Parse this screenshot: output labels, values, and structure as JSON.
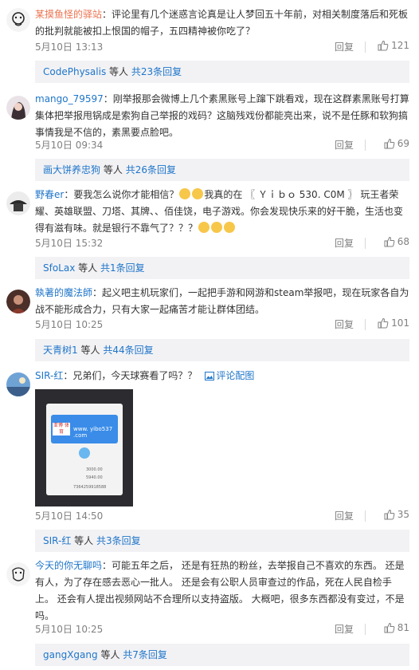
{
  "comments": [
    {
      "user": "某摸鱼怪的驿站",
      "text": "：评论里有几个迷惑言论真是让人梦回五十年前，对相关制度落后和死板的批判就能被扣上恨国的帽子，五四精神被你吃了？",
      "time": "5月10日 13:13",
      "reply_label": "回复",
      "likes": "121",
      "sub_user": "CodePhysalis",
      "sub_others": "等人",
      "sub_total": "共23条回复"
    },
    {
      "user": "mango_79597",
      "text": "：刚举报那会微博上几个素黑账号上蹿下跳看戏，现在这群素黑账号打算集体把举报甩锅成是索狗自己举报的戏码？这脑残戏份都能亮出来，说不是任豚和软狗搞事情我是不信的，素黑要点脸吧。",
      "time": "5月10日 09:34",
      "reply_label": "回复",
      "likes": "69",
      "sub_user": "画大饼养忠狗",
      "sub_others": "等人",
      "sub_total": "共26条回复"
    },
    {
      "user": "野春er",
      "text_a": "：要我怎么说你才能相信？",
      "text_b": "我真的在 〖 Ｙｉｂｏ 530. C0M 〗 玩王者荣耀、英雄联盟、刀塔、其牌、、佰佳饶，电子游戏。你会发现快乐来的好干脆，生活也变得有滋有味。就是银行不靠气了",
      "text_c": "？？？",
      "time": "5月10日 15:32",
      "reply_label": "回复",
      "likes": "68",
      "sub_user": "SfoLax",
      "sub_others": "等人",
      "sub_total": "共1条回复"
    },
    {
      "user": "執著的魔法師",
      "text": "：起义吧主机玩家们，一起把手游和网游和steam举报吧，现在玩家各自为战不能形成合力，只有大家一起痛苦才能让群体团结。",
      "time": "5月10日 10:25",
      "reply_label": "回复",
      "likes": "101",
      "sub_user": "天青树1",
      "sub_others": "等人",
      "sub_total": "共44条回复"
    },
    {
      "user": "SIR-红",
      "text": "：兄弟们，今天球赛看了吗？？",
      "pic_link": "评论配图",
      "image_site": "www. yibo537 .com",
      "image_badge": "亚博 体育",
      "image_line_1": "3000.00",
      "image_line_2": "5940.00",
      "image_line_3": "7364259918588",
      "time": "5月10日 14:50",
      "reply_label": "回复",
      "likes": "35",
      "sub_user": "SIR-红",
      "sub_others": "等人",
      "sub_total": "共3条回复"
    },
    {
      "user": "今天的你无聊吗",
      "text": "：可能五年之后， 还是有狂热的粉丝，去举报自己不喜欢的东西。 还是有人，为了存在感去恶心一批人。 还是会有公职人员审查过的作品，死在人民自检手上。 还会有人提出视频网站不合理所以支持盗版。 大概吧，很多东西都没有变过，不是吗。",
      "time": "5月10日 10:25",
      "reply_label": "回复",
      "likes": "81",
      "sub_user": "gangXgang",
      "sub_others": "等人",
      "sub_total": "共7条回复"
    }
  ],
  "colors": {
    "username": "#eb7350",
    "link": "#1f75c9",
    "meta": "#808080",
    "sub_bg": "#f2f2f5"
  }
}
